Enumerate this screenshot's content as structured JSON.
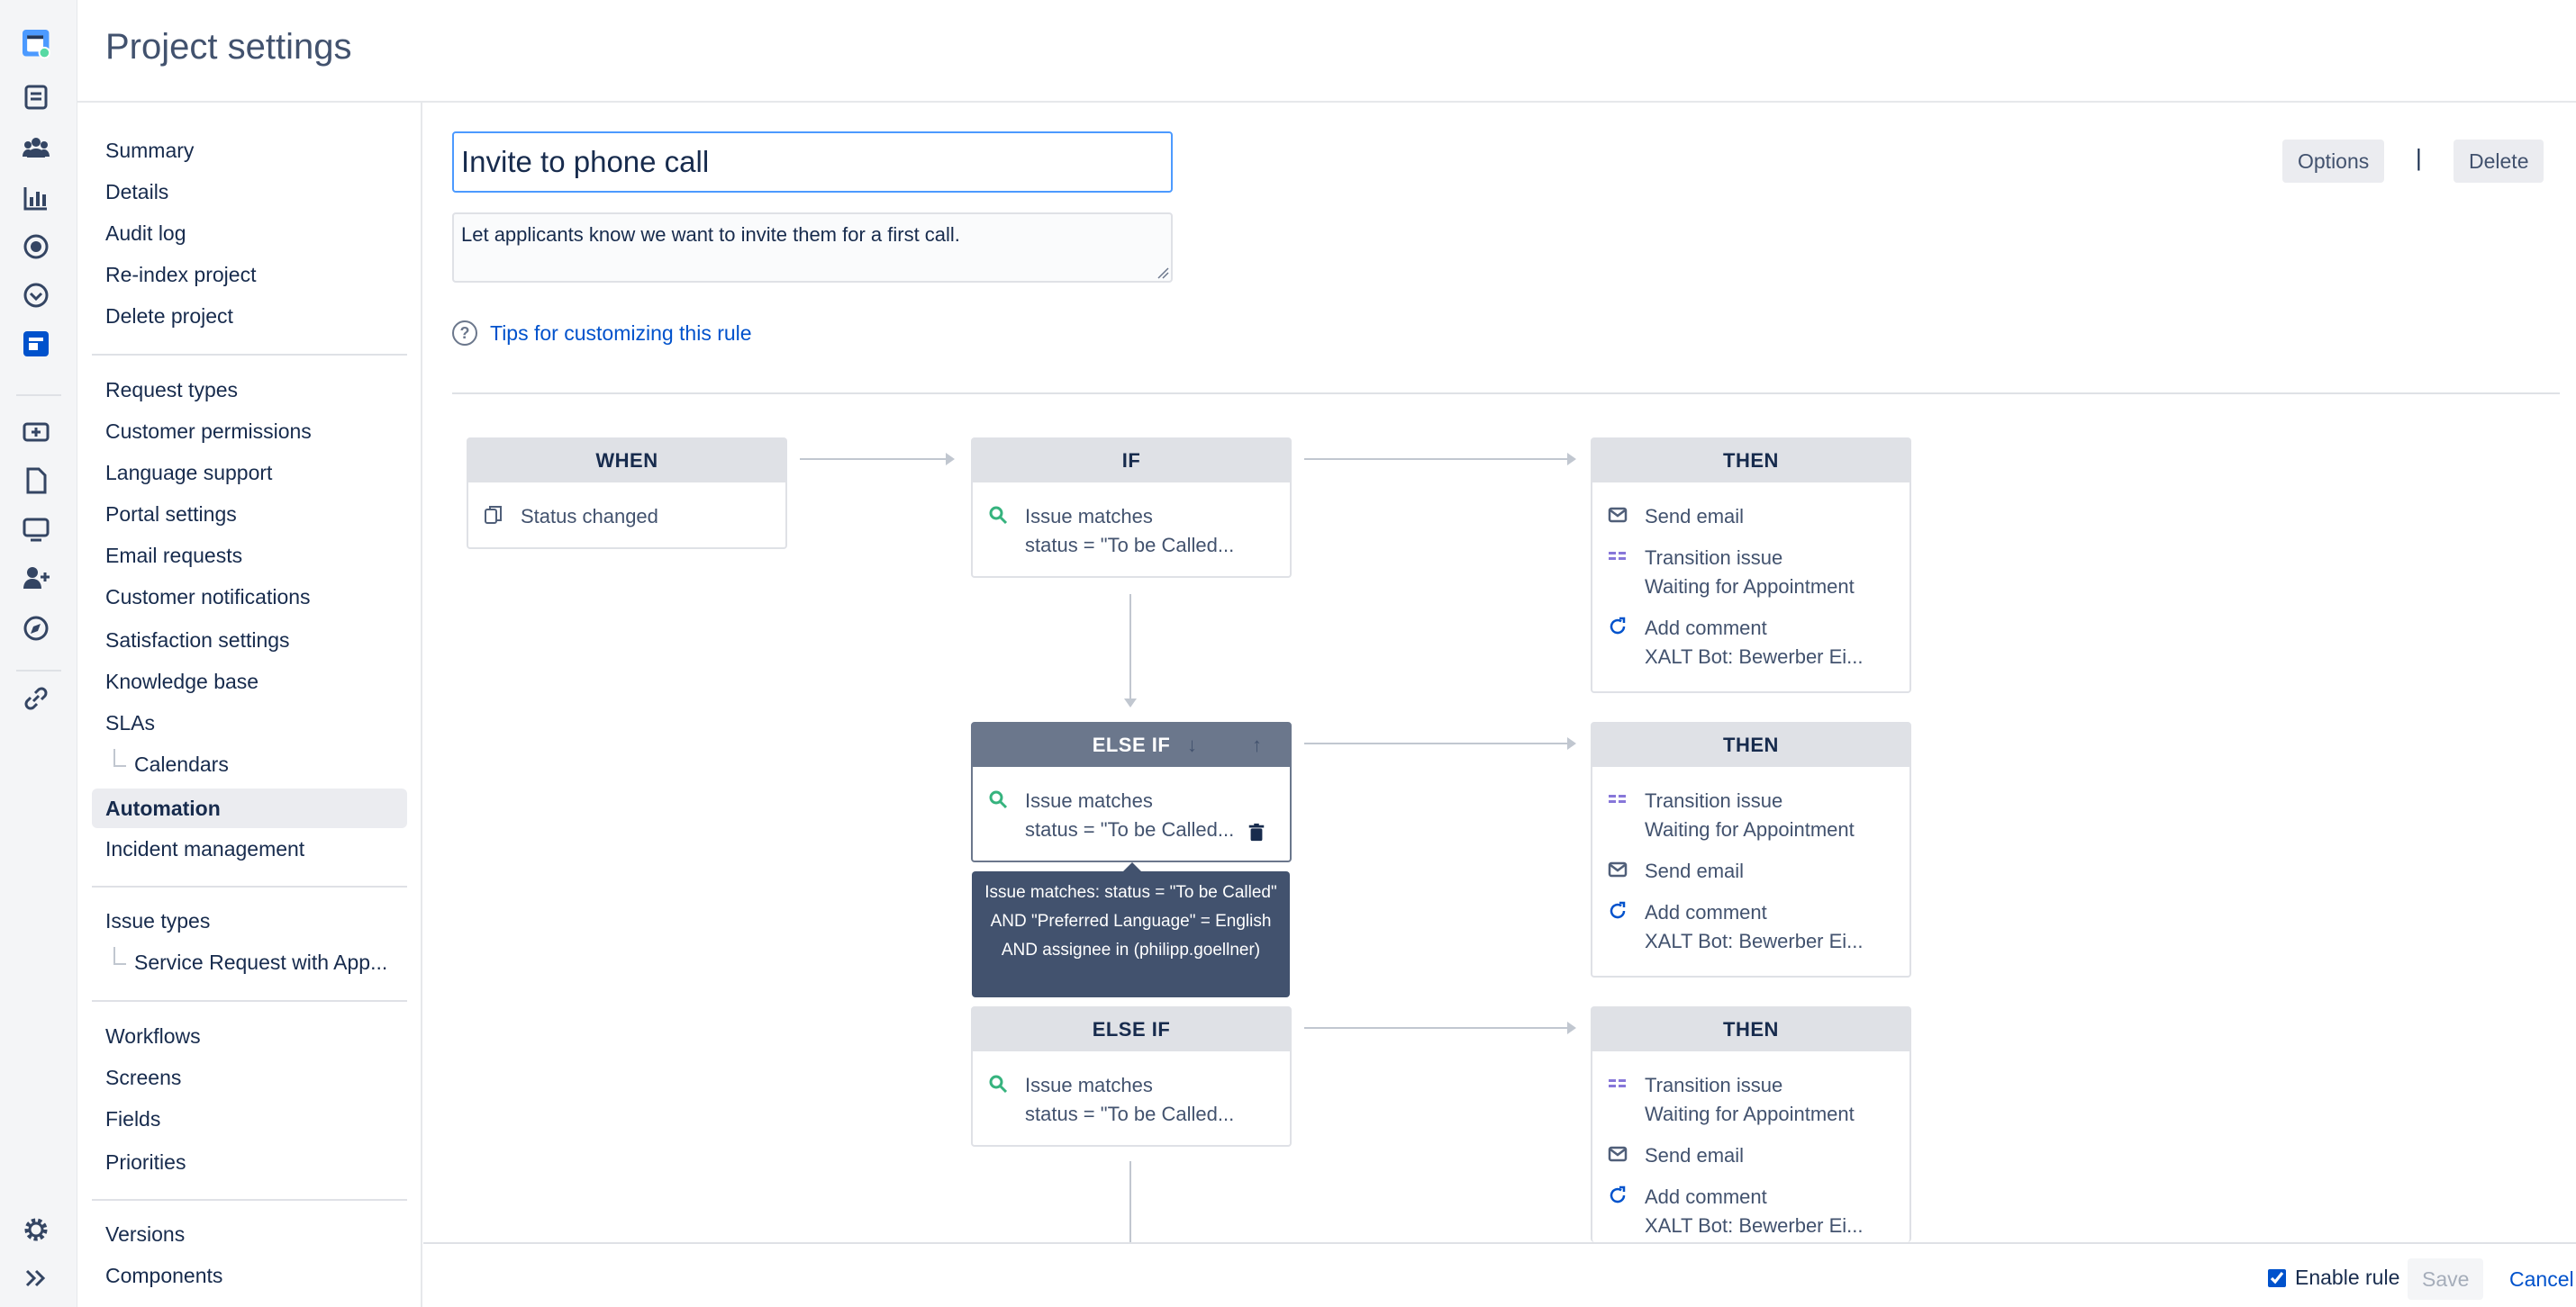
{
  "header": {
    "title": "Project settings"
  },
  "rail": {
    "icons": [
      "project-avatar-icon",
      "issues-icon",
      "customers-icon",
      "reports-icon",
      "queues-icon",
      "releases-icon",
      "service-project-icon",
      "raise-request-icon",
      "pages-icon",
      "channels-icon",
      "invite-team-icon",
      "explore-icon",
      "link-icon",
      "settings-icon",
      "expand-icon"
    ]
  },
  "sidebar": {
    "group1": [
      "Summary",
      "Details",
      "Audit log",
      "Re-index project",
      "Delete project"
    ],
    "group2": [
      "Request types",
      "Customer permissions",
      "Language support",
      "Portal settings",
      "Email requests",
      "Customer notifications",
      "Satisfaction settings",
      "Knowledge base",
      "SLAs"
    ],
    "sla_sub": "Calendars",
    "active": "Automation",
    "after_active": "Incident management",
    "issue_types": "Issue types",
    "issue_types_sub": "Service Request with App...",
    "group4": [
      "Workflows",
      "Screens",
      "Fields",
      "Priorities"
    ],
    "group5": [
      "Versions",
      "Components"
    ]
  },
  "rule": {
    "name": "Invite to phone call",
    "description": "Let applicants know we want to invite them for a first call.",
    "tips": "Tips for customizing this rule"
  },
  "actions": {
    "options": "Options",
    "separator": "|",
    "delete": "Delete"
  },
  "flow": {
    "when": {
      "header": "WHEN",
      "trigger": "Status changed"
    },
    "if": {
      "header": "IF",
      "line1": "Issue matches",
      "line2": "status = \"To be Called..."
    },
    "then1": {
      "header": "THEN",
      "a1": "Send email",
      "a2_l1": "Transition issue",
      "a2_l2": "Waiting for Appointment",
      "a3_l1": "Add comment",
      "a3_l2": "XALT Bot: Bewerber Ei..."
    },
    "elseif1": {
      "header": "ELSE IF",
      "line1": "Issue matches",
      "line2": "status = \"To be Called..."
    },
    "then2": {
      "header": "THEN",
      "a1_l1": "Transition issue",
      "a1_l2": "Waiting for Appointment",
      "a2": "Send email",
      "a3_l1": "Add comment",
      "a3_l2": "XALT Bot: Bewerber Ei..."
    },
    "tooltip": "Issue matches: status = \"To be Called\" AND \"Preferred Language\" = English AND assignee in (philipp.goellner)",
    "elseif2": {
      "header": "ELSE IF",
      "line1": "Issue matches",
      "line2": "status = \"To be Called..."
    },
    "then3": {
      "header": "THEN",
      "a1_l1": "Transition issue",
      "a1_l2": "Waiting for Appointment",
      "a2": "Send email",
      "a3_l1": "Add comment",
      "a3_l2": "XALT Bot: Bewerber Ei..."
    }
  },
  "footer": {
    "enable_label": "Enable rule",
    "enabled": true,
    "save": "Save",
    "cancel": "Cancel"
  },
  "colors": {
    "accent": "#0052cc",
    "focus": "#4c9aff",
    "condition_icon": "#36b37e",
    "action_icon": "#505f79"
  }
}
